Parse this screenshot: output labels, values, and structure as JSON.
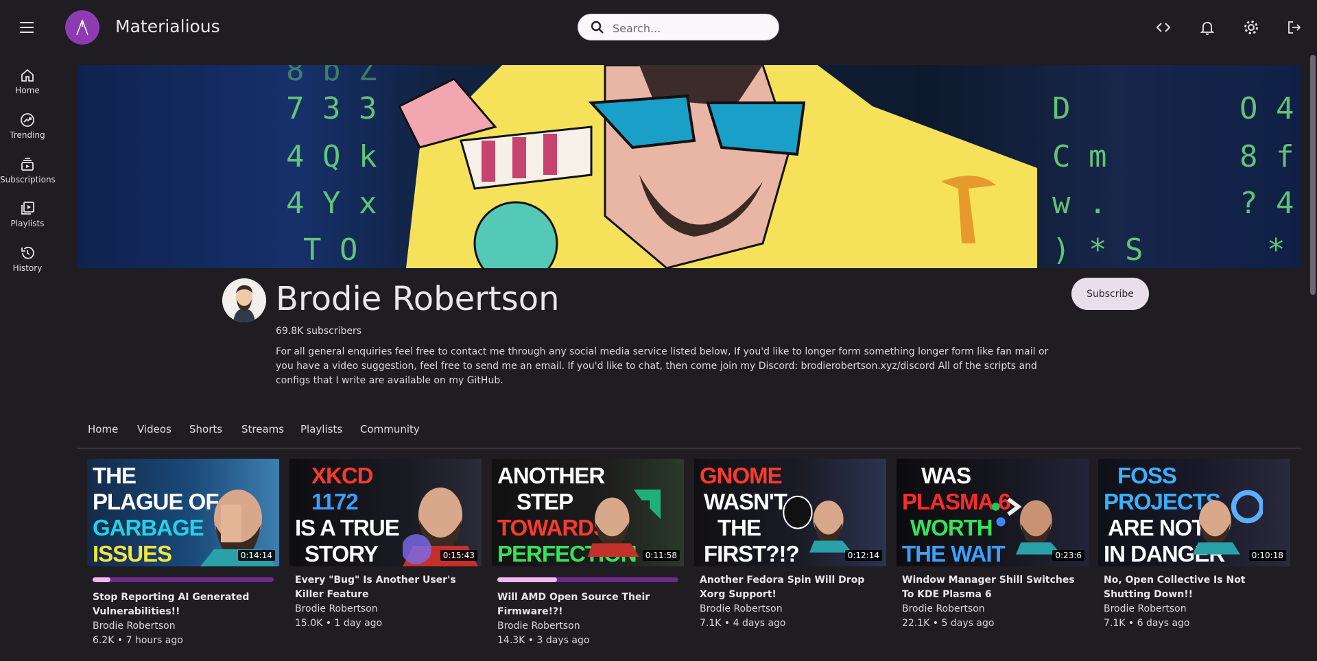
{
  "app": {
    "title": "Materialious"
  },
  "search": {
    "placeholder": "Search..."
  },
  "header_icons": [
    "code-icon",
    "bell-icon",
    "gear-icon",
    "logout-icon"
  ],
  "sidebar": {
    "items": [
      {
        "label": "Home",
        "icon": "home-icon"
      },
      {
        "label": "Trending",
        "icon": "trending-icon"
      },
      {
        "label": "Subscriptions",
        "icon": "subscriptions-icon"
      },
      {
        "label": "Playlists",
        "icon": "playlists-icon"
      },
      {
        "label": "History",
        "icon": "history-icon"
      }
    ]
  },
  "channel": {
    "name": "Brodie Robertson",
    "subscribers": "69.8K subscribers",
    "description": "For all general enquiries feel free to contact me through any social media service listed below, If you'd like to longer form something longer form like fan mail or you have a video suggestion, feel free to send me an email. If you'd like to chat, then come join my Discord: brodierobertson.xyz/discord All of the scripts and configs that I write are available on my GitHub.",
    "subscribe_label": "Subscribe"
  },
  "tabs": [
    "Home",
    "Videos",
    "Shorts",
    "Streams",
    "Playlists",
    "Community"
  ],
  "videos": [
    {
      "thumb_lines": [
        "THE",
        "PLAGUE OF",
        "GARBAGE",
        "ISSUES"
      ],
      "duration": "0:14:14",
      "progress": 0.1,
      "title": "Stop Reporting AI Generated Vulnerabilities!!",
      "channel": "Brodie Robertson",
      "meta": "6.2K • 7 hours ago"
    },
    {
      "thumb_lines": [
        "XKCD",
        "1172",
        "IS A TRUE",
        "STORY"
      ],
      "duration": "0:15:43",
      "progress": null,
      "title": "Every \"Bug\" Is Another User's Killer Feature",
      "channel": "Brodie Robertson",
      "meta": "15.0K • 1 day ago"
    },
    {
      "thumb_lines": [
        "ANOTHER",
        "STEP",
        "TOWARDS",
        "PERFECTION"
      ],
      "duration": "0:11:58",
      "progress": 0.33,
      "title": "Will AMD Open Source Their Firmware!?!",
      "channel": "Brodie Robertson",
      "meta": "14.3K • 3 days ago"
    },
    {
      "thumb_lines": [
        "GNOME",
        "WASN'T",
        "THE",
        "FIRST?!?"
      ],
      "duration": "0:12:14",
      "progress": null,
      "title": "Another Fedora Spin Will Drop Xorg Support!",
      "channel": "Brodie Robertson",
      "meta": "7.1K • 4 days ago"
    },
    {
      "thumb_lines": [
        "WAS",
        "PLASMA 6",
        "WORTH",
        "THE WAIT"
      ],
      "duration": "0:23:6",
      "progress": null,
      "title": "Window Manager Shill Switches To KDE Plasma 6",
      "channel": "Brodie Robertson",
      "meta": "22.1K • 5 days ago"
    },
    {
      "thumb_lines": [
        "FOSS",
        "PROJECTS",
        "ARE NOT",
        "IN DANGER"
      ],
      "duration": "0:10:18",
      "progress": null,
      "title": "No, Open Collective Is Not Shutting Down!!",
      "channel": "Brodie Robertson",
      "meta": "7.1K • 6 days ago"
    }
  ],
  "colors": {
    "background": "#1f1d22",
    "accent": "#8e3bb3",
    "progress_track": "#6c2c8c",
    "progress_fill": "#f1b8f1"
  }
}
